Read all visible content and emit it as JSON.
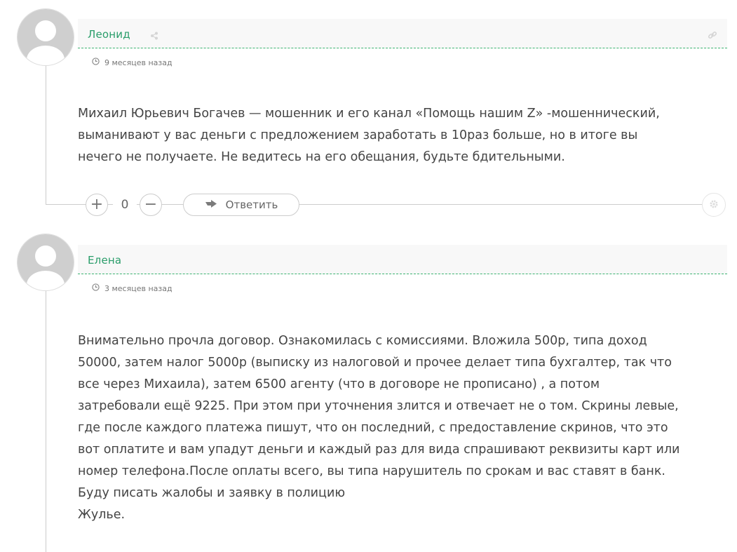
{
  "comments": [
    {
      "author": "Леонид",
      "time": "9 месяцев назад",
      "text": [
        "Михаил Юрьевич Богачев — мошенник и его канал «Помощь нашим Z» -мошеннический,",
        "выманивают у вас деньги с предложением заработать в 10раз больше, но в итоге вы",
        "нечего не получаете. Не ведитесь на его обещания, будьте бдительными."
      ],
      "vote_count": "0",
      "reply_label": "Ответить"
    },
    {
      "author": "Елена",
      "time": "3 месяцев назад",
      "text": [
        "Внимательно прочла договор. Ознакомилась с комиссиями. Вложила 500р, типа доход",
        "50000, затем налог 5000р (выписку из налоговой и прочее делает типа бухгалтер, так что",
        "все через Михаила), затем 6500 агенту (что в договоре не прописано) , а потом",
        "затребовали ещё 9225. При этом при уточнения злится и отвечает не о том. Скрины левые,",
        "где после каждого платежа пишут, что он последний, с предоставление скринов, что это",
        "вот оплатите и вам упадут деньги и каждый раз для вида спрашивают реквизиты карт или",
        "номер телефона.После оплаты всего, вы типа нарушитель по срокам и вас ставят в банк.",
        "Буду писать жалобы и заявку в полицию",
        "Жулье."
      ]
    }
  ],
  "icons": {
    "avatar": "default-user-avatar",
    "share": "share-icon",
    "link": "link-icon",
    "clock": "clock-icon",
    "plus": "+",
    "minus": "−",
    "reply": "reply-arrow-icon",
    "settings": "gear-icon"
  },
  "colors": {
    "author": "#2a9d6a",
    "divider": "#3cb371",
    "header_bg": "#f8f8f8",
    "text": "#444444"
  }
}
